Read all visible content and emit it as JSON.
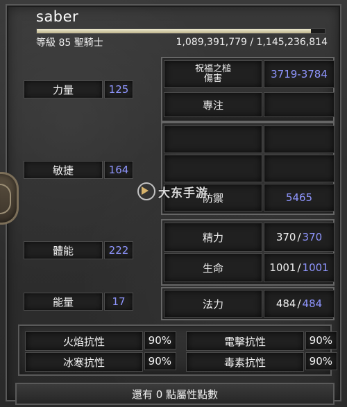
{
  "character": {
    "name": "saber",
    "level_text": "等級 85 聖騎士",
    "experience_text": "1,089,391,779 / 1,145,236,814",
    "experience_progress": 0.951
  },
  "attributes": [
    {
      "label": "力量",
      "value": "125"
    },
    {
      "label": "敏捷",
      "value": "164"
    },
    {
      "label": "體能",
      "value": "222"
    },
    {
      "label": "能量",
      "value": "17"
    }
  ],
  "combat": {
    "weapon_line1": "祝福之槌",
    "weapon_line2": "傷害",
    "damage": "3719-3784",
    "secondary_label": "專注",
    "secondary_value": "",
    "defense_label": "防禦",
    "defense_value": "5465"
  },
  "vitals": [
    {
      "label": "精力",
      "current": "370",
      "max": "370"
    },
    {
      "label": "生命",
      "current": "1001",
      "max": "1001"
    },
    {
      "label": "法力",
      "current": "484",
      "max": "484"
    }
  ],
  "resistances": [
    {
      "label": "火焰抗性",
      "value": "90%"
    },
    {
      "label": "電擊抗性",
      "value": "90%"
    },
    {
      "label": "冰寒抗性",
      "value": "90%"
    },
    {
      "label": "毒素抗性",
      "value": "90%"
    }
  ],
  "unspent_points_text": "還有 0 點屬性點數",
  "watermark": {
    "text": "大东手游"
  }
}
